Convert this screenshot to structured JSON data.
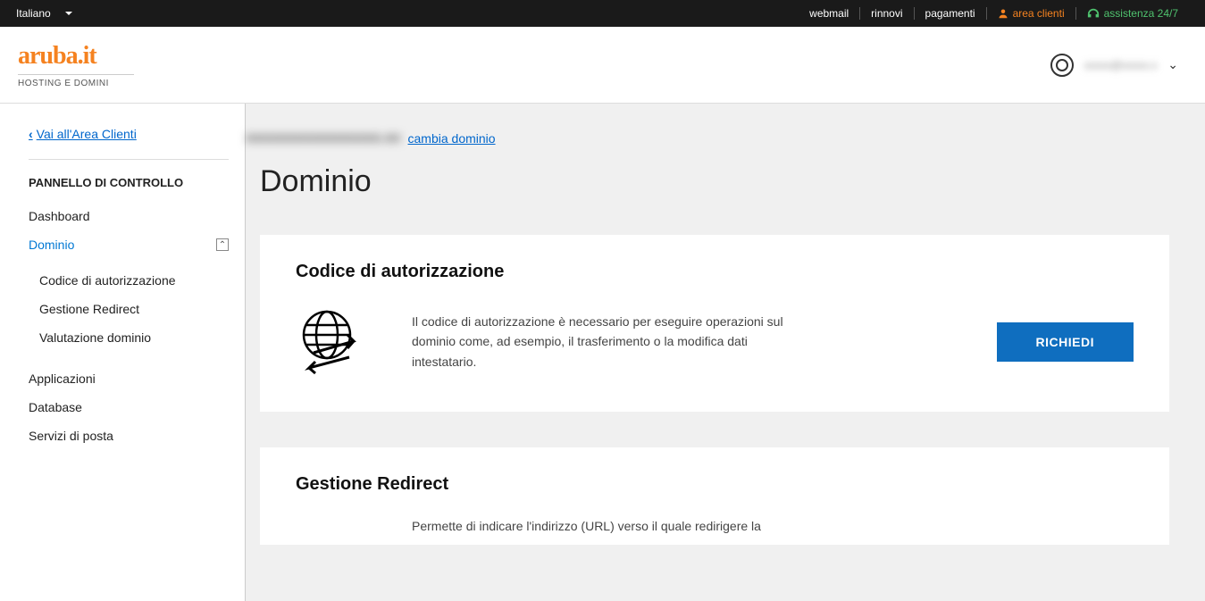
{
  "topbar": {
    "language": "Italiano",
    "links": {
      "webmail": "webmail",
      "rinnovi": "rinnovi",
      "pagamenti": "pagamenti",
      "area_clienti": "area clienti",
      "assistenza": "assistenza 24/7"
    }
  },
  "header": {
    "logo": "aruba.it",
    "tagline": "HOSTING E DOMINI",
    "user_email": "xxxxx@xxxxx.x"
  },
  "sidebar": {
    "back_link": "Vai all'Area Clienti",
    "panel_title": "PANNELLO DI CONTROLLO",
    "items": {
      "dashboard": "Dashboard",
      "dominio": "Dominio",
      "dominio_sub": {
        "codice": "Codice di autorizzazione",
        "redirect": "Gestione Redirect",
        "valutazione": "Valutazione dominio"
      },
      "applicazioni": "Applicazioni",
      "database": "Database",
      "posta": "Servizi di posta"
    }
  },
  "main": {
    "domain_name": "xxxxxxxxxxxxxxxxx.xx",
    "change_domain": "cambia dominio",
    "page_title": "Dominio",
    "card1": {
      "title": "Codice di autorizzazione",
      "text": "Il codice di autorizzazione è necessario per eseguire operazioni sul dominio come, ad esempio, il trasferimento o la modifica dati intestatario.",
      "button": "RICHIEDI"
    },
    "card2": {
      "title": "Gestione Redirect",
      "text": "Permette di indicare l'indirizzo (URL) verso il quale redirigere la"
    }
  }
}
